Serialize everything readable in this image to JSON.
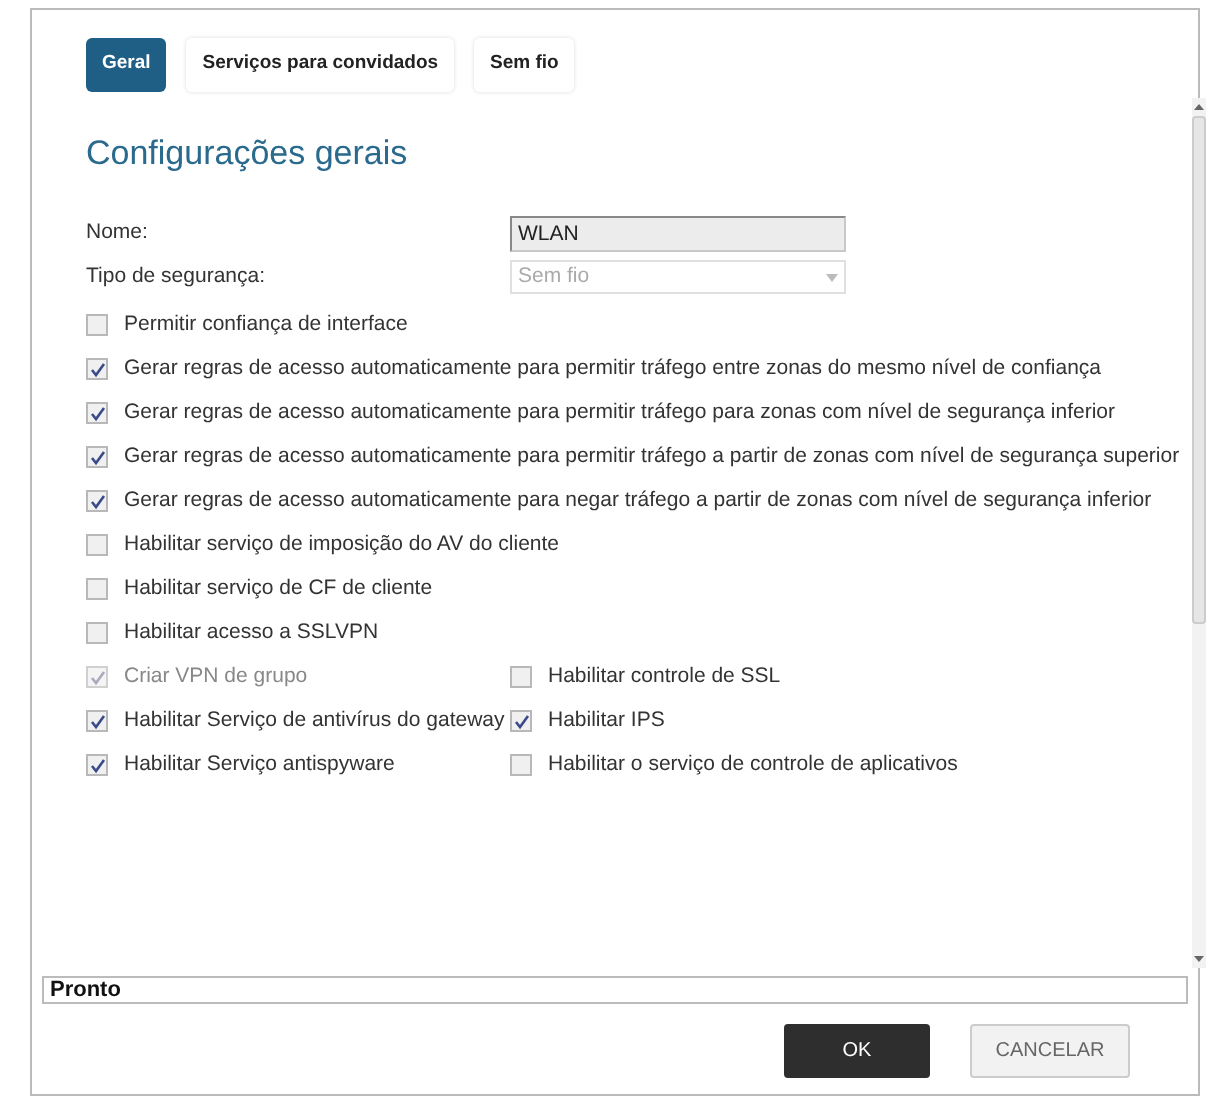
{
  "tabs": [
    {
      "label": "Geral",
      "selected": true
    },
    {
      "label": "Serviços para convidados",
      "selected": false
    },
    {
      "label": "Sem fio",
      "selected": false
    }
  ],
  "heading": "Configurações gerais",
  "fields": [
    {
      "label": "Nome:",
      "kind": "text",
      "value": "WLAN"
    },
    {
      "label": "Tipo de segurança:",
      "kind": "select",
      "value": "Sem fio"
    }
  ],
  "options": [
    {
      "label": "Permitir confiança de interface",
      "checked": false,
      "disabled": false
    },
    {
      "label": "Gerar regras de acesso automaticamente para permitir tráfego entre zonas do mesmo nível de confiança",
      "checked": true,
      "disabled": false
    },
    {
      "label": "Gerar regras de acesso automaticamente para permitir tráfego para zonas com nível de segurança inferior",
      "checked": true,
      "disabled": false
    },
    {
      "label": "Gerar regras de acesso automaticamente para permitir tráfego a partir de zonas com nível de segurança superior",
      "checked": true,
      "disabled": false
    },
    {
      "label": "Gerar regras de acesso automaticamente para negar tráfego a partir de zonas com nível de segurança inferior",
      "checked": true,
      "disabled": false
    },
    {
      "label": "Habilitar serviço de imposição do AV do cliente",
      "checked": false,
      "disabled": false
    },
    {
      "label": "Habilitar serviço de CF de cliente",
      "checked": false,
      "disabled": false
    },
    {
      "label": "Habilitar acesso a SSLVPN",
      "checked": false,
      "disabled": false
    }
  ],
  "option_pairs": [
    [
      {
        "label": "Criar VPN de grupo",
        "checked": true,
        "disabled": true
      },
      {
        "label": "Habilitar controle de SSL",
        "checked": false,
        "disabled": false
      }
    ],
    [
      {
        "label": "Habilitar Serviço de antivírus do gateway",
        "checked": true,
        "disabled": false
      },
      {
        "label": "Habilitar IPS",
        "checked": true,
        "disabled": false
      }
    ],
    [
      {
        "label": "Habilitar Serviço antispyware",
        "checked": true,
        "disabled": false
      },
      {
        "label": "Habilitar o serviço de controle de aplicativos",
        "checked": false,
        "disabled": false
      }
    ]
  ],
  "status_bar": "Pronto",
  "buttons": [
    {
      "label": "OK",
      "kind": "primary"
    },
    {
      "label": "CANCELAR",
      "kind": "secondary"
    }
  ]
}
